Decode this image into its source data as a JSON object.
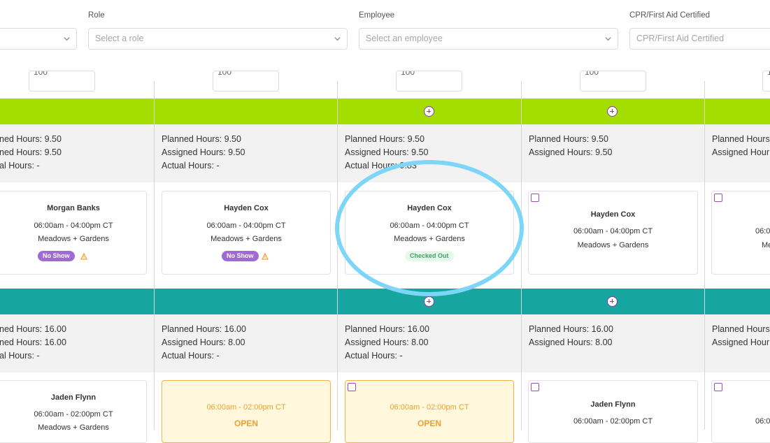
{
  "filters": {
    "role": {
      "label": "Role",
      "placeholder": "Select a role"
    },
    "employee": {
      "label": "Employee",
      "placeholder": "Select an employee"
    },
    "cpr": {
      "label": "CPR/First Aid Certified",
      "placeholder": "CPR/First Aid Certified"
    }
  },
  "numbox_value": "100",
  "summary1": [
    {
      "planned": "ned Hours: 9.50",
      "assigned": "ned Hours: 9.50",
      "actual": "al Hours: -"
    },
    {
      "planned": "Planned Hours: 9.50",
      "assigned": "Assigned Hours: 9.50",
      "actual": "Actual Hours: -"
    },
    {
      "planned": "Planned Hours: 9.50",
      "assigned": "Assigned Hours: 9.50",
      "actual": "Actual Hours: 9.83"
    },
    {
      "planned": "Planned Hours: 9.50",
      "assigned": "Assigned Hours: 9.50",
      "actual": ""
    },
    {
      "planned": "Planned Hours",
      "assigned": "Assigned Hour",
      "actual": ""
    }
  ],
  "row1_cards": [
    {
      "name": "Morgan Banks",
      "time": "06:00am - 04:00pm CT",
      "location": "Meadows + Gardens",
      "badge": "No Show"
    },
    {
      "name": "Hayden Cox",
      "time": "06:00am - 04:00pm CT",
      "location": "Meadows + Gardens",
      "badge": "No Show"
    },
    {
      "name": "Hayden Cox",
      "time": "06:00am - 04:00pm CT",
      "location": "Meadows + Gardens",
      "badge": "Checked Out"
    },
    {
      "name": "Hayden Cox",
      "time": "06:00am - 04:00pm CT",
      "location": "Meadows + Gardens"
    },
    {
      "time": "06:0",
      "location": "Me"
    }
  ],
  "summary2": [
    {
      "planned": "ned Hours: 16.00",
      "assigned": "ned Hours: 16.00",
      "actual": "al Hours: -"
    },
    {
      "planned": "Planned Hours: 16.00",
      "assigned": "Assigned Hours: 8.00",
      "actual": "Actual Hours: -"
    },
    {
      "planned": "Planned Hours: 16.00",
      "assigned": "Assigned Hours: 8.00",
      "actual": "Actual Hours: -"
    },
    {
      "planned": "Planned Hours: 16.00",
      "assigned": "Assigned Hours: 8.00",
      "actual": ""
    },
    {
      "planned": "Planned Hours",
      "assigned": "Assigned Hour",
      "actual": ""
    }
  ],
  "row2_cards": [
    {
      "name": "Jaden Flynn",
      "time": "06:00am - 02:00pm CT",
      "location": "Meadows + Gardens"
    },
    {
      "time": "06:00am - 02:00pm CT",
      "status": "OPEN"
    },
    {
      "time": "06:00am - 02:00pm CT",
      "status": "OPEN"
    },
    {
      "name": "Jaden Flynn",
      "time": "06:00am - 02:00pm CT"
    },
    {
      "time": "06:0"
    }
  ],
  "colors": {
    "band_green": "#a3de00",
    "band_teal": "#17a5a0",
    "no_show": "#9f6ad6",
    "checked_out": "#3aa860",
    "open": "#f0a030",
    "highlight": "#7dd6f7"
  }
}
